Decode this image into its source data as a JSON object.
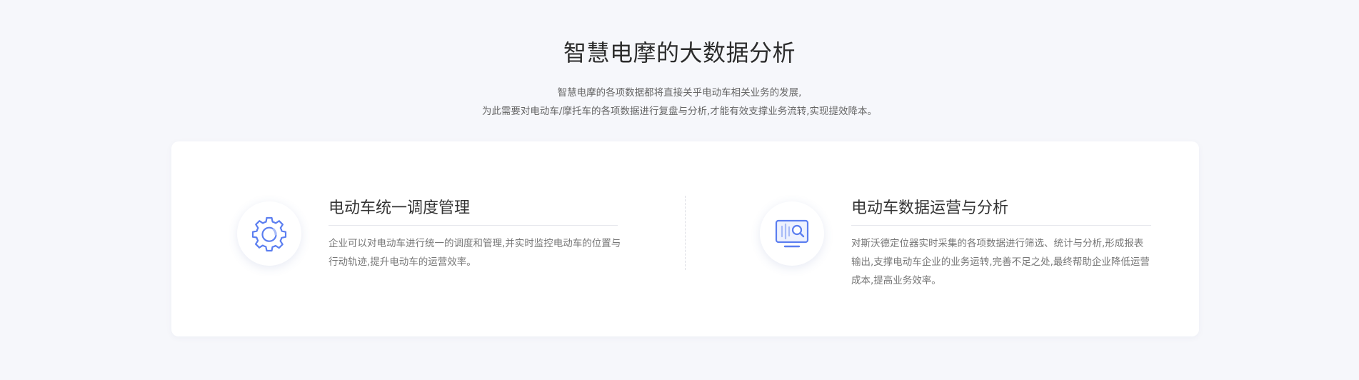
{
  "section": {
    "title": "智慧电摩的大数据分析",
    "subtitle_line1": "智慧电摩的各项数据都将直接关乎电动车相关业务的发展,",
    "subtitle_line2": "为此需要对电动车/摩托车的各项数据进行复盘与分析,才能有效支撑业务流转,实现提效降本。"
  },
  "features": [
    {
      "icon": "gear-icon",
      "title": "电动车统一调度管理",
      "description": "企业可以对电动车进行统一的调度和管理,并实时监控电动车的位置与行动轨迹,提升电动车的运营效率。"
    },
    {
      "icon": "monitor-search-icon",
      "title": "电动车数据运营与分析",
      "description": "对斯沃德定位器实时采集的各项数据进行筛选、统计与分析,形成报表输出,支撑电动车企业的业务运转,完善不足之处,最终帮助企业降低运营成本,提高业务效率。"
    }
  ],
  "colors": {
    "accent": "#5b7ef0",
    "background": "#f6f7fb",
    "card": "#ffffff"
  }
}
